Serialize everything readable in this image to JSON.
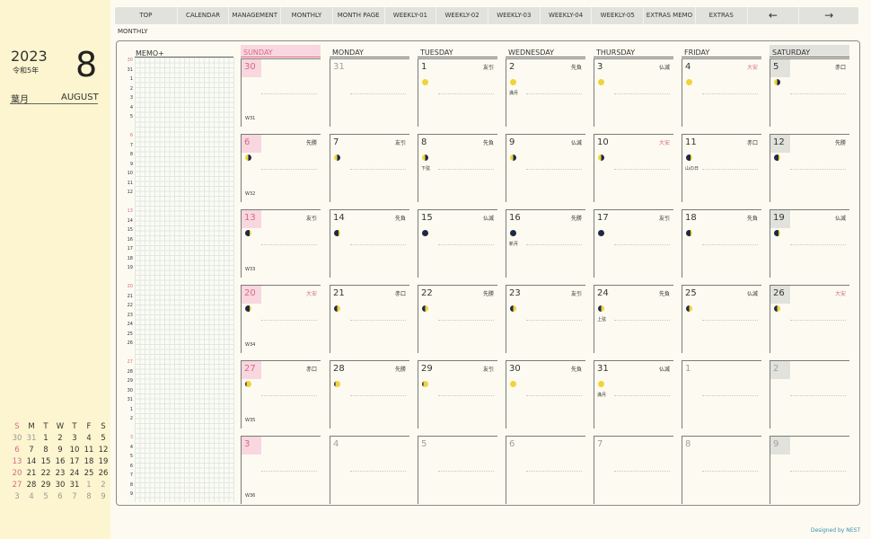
{
  "sidebar": {
    "year": "2023",
    "era": "令和5年",
    "month_num": "8",
    "month_jp": "葉月",
    "month_en": "AUGUST",
    "mini_calendar": {
      "headers": [
        "S",
        "M",
        "T",
        "W",
        "T",
        "F",
        "S"
      ],
      "rows": [
        [
          {
            "d": "30",
            "s": "dim"
          },
          {
            "d": "31",
            "s": "dim"
          },
          {
            "d": "1",
            "s": ""
          },
          {
            "d": "2",
            "s": ""
          },
          {
            "d": "3",
            "s": ""
          },
          {
            "d": "4",
            "s": ""
          },
          {
            "d": "5",
            "s": ""
          }
        ],
        [
          {
            "d": "6",
            "s": "sun"
          },
          {
            "d": "7",
            "s": ""
          },
          {
            "d": "8",
            "s": ""
          },
          {
            "d": "9",
            "s": ""
          },
          {
            "d": "10",
            "s": ""
          },
          {
            "d": "11",
            "s": ""
          },
          {
            "d": "12",
            "s": ""
          }
        ],
        [
          {
            "d": "13",
            "s": "sun"
          },
          {
            "d": "14",
            "s": ""
          },
          {
            "d": "15",
            "s": ""
          },
          {
            "d": "16",
            "s": ""
          },
          {
            "d": "17",
            "s": ""
          },
          {
            "d": "18",
            "s": ""
          },
          {
            "d": "19",
            "s": ""
          }
        ],
        [
          {
            "d": "20",
            "s": "sun"
          },
          {
            "d": "21",
            "s": ""
          },
          {
            "d": "22",
            "s": ""
          },
          {
            "d": "23",
            "s": ""
          },
          {
            "d": "24",
            "s": ""
          },
          {
            "d": "25",
            "s": ""
          },
          {
            "d": "26",
            "s": ""
          }
        ],
        [
          {
            "d": "27",
            "s": "sun"
          },
          {
            "d": "28",
            "s": ""
          },
          {
            "d": "29",
            "s": ""
          },
          {
            "d": "30",
            "s": ""
          },
          {
            "d": "31",
            "s": ""
          },
          {
            "d": "1",
            "s": "dim"
          },
          {
            "d": "2",
            "s": "dim"
          }
        ],
        [
          {
            "d": "3",
            "s": "dim"
          },
          {
            "d": "4",
            "s": "dim"
          },
          {
            "d": "5",
            "s": "dim"
          },
          {
            "d": "6",
            "s": "dim"
          },
          {
            "d": "7",
            "s": "dim"
          },
          {
            "d": "8",
            "s": "dim"
          },
          {
            "d": "9",
            "s": "dim"
          }
        ]
      ]
    }
  },
  "tabs": [
    {
      "label": "TOP",
      "name": "tab-top"
    },
    {
      "label": "CALENDAR",
      "name": "tab-calendar"
    },
    {
      "label": "MANAGEMENT",
      "name": "tab-management"
    },
    {
      "label": "MONTHLY",
      "name": "tab-monthly"
    },
    {
      "label": "MONTH PAGE",
      "name": "tab-month-page"
    },
    {
      "label": "WEEKLY-01",
      "name": "tab-weekly-01"
    },
    {
      "label": "WEEKLY-02",
      "name": "tab-weekly-02"
    },
    {
      "label": "WEEKLY-03",
      "name": "tab-weekly-03"
    },
    {
      "label": "WEEKLY-04",
      "name": "tab-weekly-04"
    },
    {
      "label": "WEEKLY-05",
      "name": "tab-weekly-05"
    },
    {
      "label": "EXTRAS MEMO",
      "name": "tab-extras-memo"
    },
    {
      "label": "EXTRAS",
      "name": "tab-extras"
    },
    {
      "label": "←",
      "name": "prev-arrow-button"
    },
    {
      "label": "→",
      "name": "next-arrow-button"
    }
  ],
  "view_label": "MONTHLY",
  "memo_label": "MEMO+",
  "hour_blocks": [
    [
      "30",
      "31",
      "1",
      "2",
      "3",
      "4",
      "5"
    ],
    [
      "6",
      "7",
      "8",
      "9",
      "10",
      "11",
      "12"
    ],
    [
      "13",
      "14",
      "15",
      "16",
      "17",
      "18",
      "19"
    ],
    [
      "20",
      "21",
      "22",
      "23",
      "24",
      "25",
      "26"
    ],
    [
      "27",
      "28",
      "29",
      "30",
      "31",
      "1",
      "2"
    ],
    [
      "3",
      "4",
      "5",
      "6",
      "7",
      "8",
      "9"
    ]
  ],
  "day_headers": [
    "SUNDAY",
    "MONDAY",
    "TUESDAY",
    "WEDNESDAY",
    "THURSDAY",
    "FRIDAY",
    "SATURDAY"
  ],
  "weeks": [
    {
      "label": "W31",
      "days": [
        {
          "d": "30",
          "dim": true
        },
        {
          "d": "31",
          "dim": true
        },
        {
          "d": "1",
          "r": "友引",
          "m": "full"
        },
        {
          "d": "2",
          "r": "先負",
          "m": "full",
          "n": "満月"
        },
        {
          "d": "3",
          "r": "仏滅",
          "m": "full"
        },
        {
          "d": "4",
          "r": "大安",
          "rr": true,
          "m": "full"
        },
        {
          "d": "5",
          "r": "赤口",
          "m": "wane"
        }
      ]
    },
    {
      "label": "W32",
      "days": [
        {
          "d": "6",
          "r": "先勝",
          "m": "wane"
        },
        {
          "d": "7",
          "r": "友引",
          "m": "wane"
        },
        {
          "d": "8",
          "r": "先負",
          "m": "wane",
          "n": "下弦"
        },
        {
          "d": "9",
          "r": "仏滅",
          "m": "wane"
        },
        {
          "d": "10",
          "r": "大安",
          "rr": true,
          "m": "wane"
        },
        {
          "d": "11",
          "r": "赤口",
          "m": "cres",
          "n": "山の日"
        },
        {
          "d": "12",
          "r": "先勝",
          "m": "cres"
        }
      ]
    },
    {
      "label": "W33",
      "days": [
        {
          "d": "13",
          "r": "友引",
          "m": "cres"
        },
        {
          "d": "14",
          "r": "先負",
          "m": "cres"
        },
        {
          "d": "15",
          "r": "仏滅",
          "m": "new"
        },
        {
          "d": "16",
          "r": "先勝",
          "m": "new",
          "n": "新月"
        },
        {
          "d": "17",
          "r": "友引",
          "m": "new"
        },
        {
          "d": "18",
          "r": "先負",
          "m": "cres"
        },
        {
          "d": "19",
          "r": "仏滅",
          "m": "cres"
        }
      ]
    },
    {
      "label": "W34",
      "days": [
        {
          "d": "20",
          "r": "大安",
          "rr": true,
          "m": "cres"
        },
        {
          "d": "21",
          "r": "赤口",
          "m": "wax"
        },
        {
          "d": "22",
          "r": "先勝",
          "m": "wax"
        },
        {
          "d": "23",
          "r": "友引",
          "m": "wax"
        },
        {
          "d": "24",
          "r": "先負",
          "m": "wax",
          "n": "上弦"
        },
        {
          "d": "25",
          "r": "仏滅",
          "m": "wax"
        },
        {
          "d": "26",
          "r": "大安",
          "rr": true,
          "m": "wax"
        }
      ]
    },
    {
      "label": "W35",
      "days": [
        {
          "d": "27",
          "r": "赤口",
          "m": "gib"
        },
        {
          "d": "28",
          "r": "先勝",
          "m": "gib"
        },
        {
          "d": "29",
          "r": "友引",
          "m": "gib"
        },
        {
          "d": "30",
          "r": "先負",
          "m": "full"
        },
        {
          "d": "31",
          "r": "仏滅",
          "m": "full",
          "n": "満月"
        },
        {
          "d": "1",
          "dim": true
        },
        {
          "d": "2",
          "dim": true
        }
      ]
    },
    {
      "label": "W36",
      "days": [
        {
          "d": "3",
          "dim": true
        },
        {
          "d": "4",
          "dim": true
        },
        {
          "d": "5",
          "dim": true
        },
        {
          "d": "6",
          "dim": true
        },
        {
          "d": "7",
          "dim": true
        },
        {
          "d": "8",
          "dim": true
        },
        {
          "d": "9",
          "dim": true
        }
      ]
    }
  ],
  "credit": "Designed by NEST",
  "colors": {
    "sunday": "#d46b86",
    "sidebar": "#fcf5cf",
    "accent_credit": "#3a8fb0"
  }
}
